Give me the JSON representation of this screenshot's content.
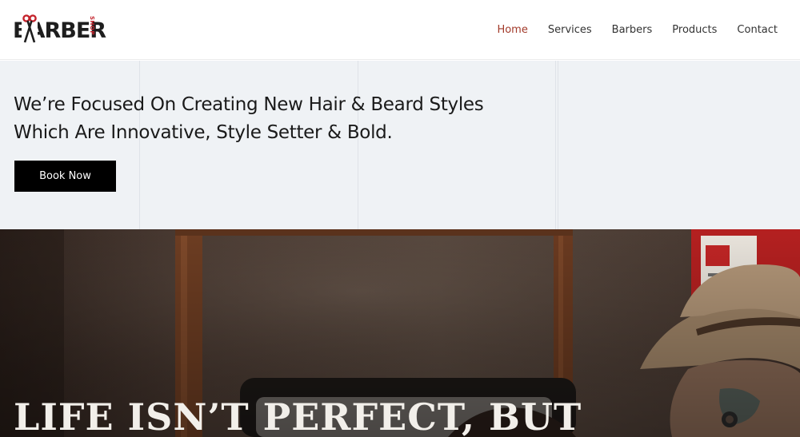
{
  "header": {
    "logo": {
      "word": "BARBER",
      "sub": "SHOP",
      "icon": "scissors-icon",
      "accent_color": "#c4222b"
    },
    "nav": [
      {
        "label": "Home",
        "active": true
      },
      {
        "label": "Services",
        "active": false
      },
      {
        "label": "Barbers",
        "active": false
      },
      {
        "label": "Products",
        "active": false
      },
      {
        "label": "Contact",
        "active": false
      }
    ],
    "active_color": "#a23a2a"
  },
  "hero": {
    "line1": "We’re Focused On Creating New Hair & Beard Styles",
    "line2": "Which Are Innovative, Style Setter & Bold.",
    "button_label": "Book Now",
    "background": "#eff2f5"
  },
  "photo": {
    "heading": "LIFE ISN’T PERFECT, BUT"
  }
}
